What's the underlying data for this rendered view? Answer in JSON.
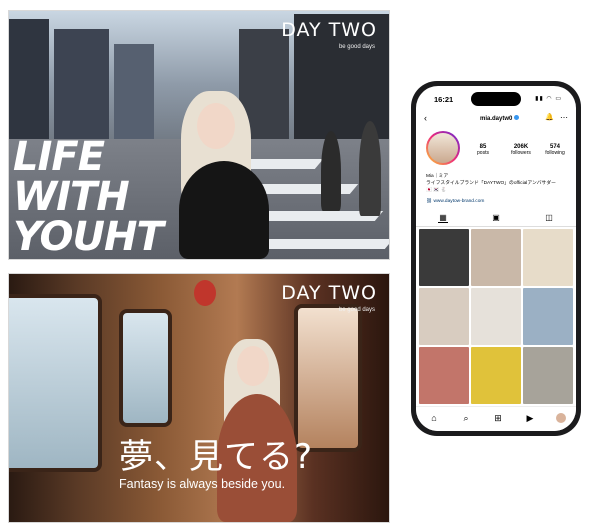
{
  "poster_city": {
    "brand": "DAY TWO",
    "tagline": "be good days",
    "title_lines": [
      "LIFE",
      "WITH",
      "YOUHT"
    ]
  },
  "poster_train": {
    "brand": "DAY TWO",
    "tagline": "be good days",
    "headline": "夢、見てる?",
    "subheadline": "Fantasy is always beside you."
  },
  "phone": {
    "status": {
      "time": "16:21",
      "icons": "▮▮ ◠ ▭"
    },
    "username": "mia.daytw0",
    "icons": {
      "back": "‹",
      "bell": "bell-icon",
      "more": "⋯"
    },
    "stats": [
      {
        "value": "85",
        "label": "posts"
      },
      {
        "value": "206K",
        "label": "followers"
      },
      {
        "value": "574",
        "label": "following"
      }
    ],
    "bio_name": "Mia｜ミア",
    "bio_text": "ライフスタイルブランド「DAYTWO」のofficialアンバサダー",
    "bio_emoji": "🇯🇵 🇰🇷 🐇",
    "link": "www.daytow-brand.com",
    "tabs": [
      "grid-icon",
      "reels-icon",
      "tagged-icon"
    ],
    "grid_colors": [
      "#3a3a3a",
      "#c9b8a8",
      "#e7dcc9",
      "#d8ccc0",
      "#e6e1da",
      "#9bb0c4",
      "#c2756a",
      "#e0c23a",
      "#a7a39a"
    ],
    "nav": [
      "home-icon",
      "search-icon",
      "add-icon",
      "reels-icon",
      "profile-avatar"
    ]
  }
}
